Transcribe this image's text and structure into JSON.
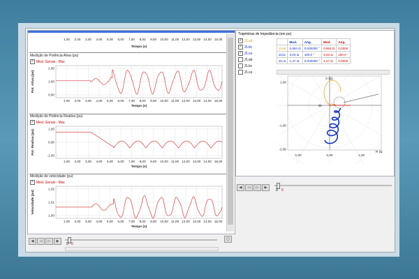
{
  "charts": [
    {
      "title": "",
      "legend": "",
      "ylabel": "",
      "xlabel": "Tempo (s)",
      "yticks": [],
      "xticks": [
        "1,00",
        "2,00",
        "3,00",
        "4,00",
        "5,00",
        "6,00",
        "7,00",
        "8,00",
        "9,00",
        "10,00",
        "11,00",
        "12,00",
        "13,00",
        "14,00",
        "15,00"
      ]
    },
    {
      "title": "Medição de Potência Ativa (pu)",
      "legend": "Med. Gerais - Mar.",
      "ylabel": "Pot. Ativa (pu)",
      "xlabel": "Tempo (s)",
      "yticks": [
        "2,00",
        "1,00",
        "0,00"
      ],
      "xticks": [
        "1,00",
        "2,00",
        "3,00",
        "4,00",
        "5,00",
        "6,00",
        "7,00",
        "8,00",
        "9,00",
        "10,00",
        "11,00",
        "12,00",
        "13,00",
        "14,00",
        "15,00"
      ]
    },
    {
      "title": "Medição de Potência Reativa (pu)",
      "legend": "Med. Gerais - Mar.",
      "ylabel": "Pot. Reativa (pu)",
      "xlabel": "Tempo (s)",
      "yticks": [
        "1,00",
        "0,00",
        "-1,00"
      ],
      "xticks": [
        "1,00",
        "2,00",
        "3,00",
        "4,00",
        "5,00",
        "6,00",
        "7,00",
        "8,00",
        "9,00",
        "10,00",
        "11,00",
        "12,00",
        "13,00",
        "14,00",
        "15,00"
      ]
    },
    {
      "title": "Medição de velocidade (pu)",
      "legend": "Med. Gerais - Mar.",
      "ylabel": "Velocidade (pu)",
      "xlabel": "Tempo (s)",
      "yticks": [
        "1,02",
        "1,01",
        "1,00"
      ],
      "xticks": [
        "1,00",
        "2,00",
        "3,00",
        "4,00",
        "5,00",
        "6,00",
        "7,00",
        "8,00",
        "9,00",
        "10,00",
        "11,00",
        "12,00",
        "13,00",
        "14,00",
        "15,00"
      ]
    }
  ],
  "playback_left": {
    "pos_label": "0",
    "val_label": "0",
    "position": 0.02
  },
  "impedance": {
    "title": "Trajetórias de Impedância (em pu)",
    "list": [
      {
        "label": "ZLab",
        "checked": true,
        "color": "#e8a020"
      },
      {
        "label": "ZLbc",
        "checked": true,
        "color": "#1030c0"
      },
      {
        "label": "ZLca",
        "checked": true,
        "color": "#1030c0"
      },
      {
        "label": "ZLab",
        "checked": false,
        "color": "#222222"
      },
      {
        "label": "ZLbc",
        "checked": false,
        "color": "#222222"
      },
      {
        "label": "ZLca",
        "checked": false,
        "color": "#222222"
      }
    ],
    "headers": [
      "",
      "Mod.",
      "Ang.",
      "Mod.",
      "Ang."
    ],
    "rows": [
      [
        "ZLab",
        "0,654 Ω",
        "0,000000 °",
        "0,654 Ω",
        "0,0000"
      ],
      [
        "ZLbc",
        "3,03 Ω",
        "180,0 °",
        "3,03 Ω",
        "180,0 °"
      ],
      [
        "ZLca",
        "1,47 Ω",
        "0,000000 °",
        "1,47 Ω",
        "0,0000"
      ]
    ],
    "plot": {
      "xlabel": "R (Ω)",
      "ylabel": "X (Ω)",
      "xticks": [
        "-1,00",
        "0,00",
        "1,00"
      ],
      "yticks": [
        "1,00",
        "-1,00",
        "-2,00"
      ],
      "center_label": "Zb"
    }
  },
  "playback_right": {
    "pos_label": "0",
    "val_label": "0",
    "position": 0.02
  },
  "colors": {
    "trace": "#d42020",
    "traj_blue": "#1030c0",
    "traj_orange": "#e8a020"
  }
}
